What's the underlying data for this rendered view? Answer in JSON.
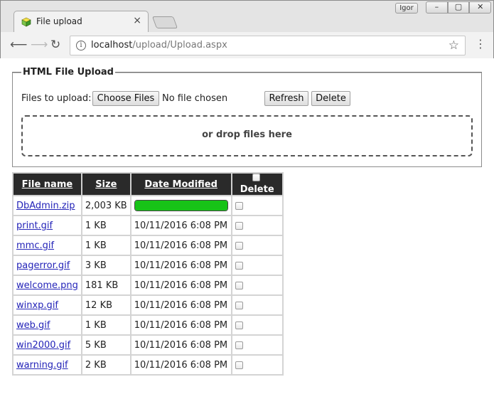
{
  "browser": {
    "tab_title": "File upload",
    "tab_close": "×",
    "user_name": "Igor",
    "url_host": "localhost",
    "url_path": "/upload/Upload.aspx"
  },
  "upload": {
    "legend": "HTML File Upload",
    "files_label": "Files to upload:",
    "choose_button": "Choose Files",
    "no_file_text": "No file chosen",
    "refresh_button": "Refresh",
    "delete_button": "Delete",
    "drop_text": "or drop files here"
  },
  "table": {
    "headers": {
      "name": "File name",
      "size": "Size",
      "date": "Date Modified",
      "delete": "Delete"
    },
    "rows": [
      {
        "name": "DbAdmin.zip",
        "size": "2,003 KB",
        "date": "",
        "progress": 1.0
      },
      {
        "name": "print.gif",
        "size": "1 KB",
        "date": "10/11/2016 6:08 PM"
      },
      {
        "name": "mmc.gif",
        "size": "1 KB",
        "date": "10/11/2016 6:08 PM"
      },
      {
        "name": "pagerror.gif",
        "size": "3 KB",
        "date": "10/11/2016 6:08 PM"
      },
      {
        "name": "welcome.png",
        "size": "181 KB",
        "date": "10/11/2016 6:08 PM"
      },
      {
        "name": "winxp.gif",
        "size": "12 KB",
        "date": "10/11/2016 6:08 PM"
      },
      {
        "name": "web.gif",
        "size": "1 KB",
        "date": "10/11/2016 6:08 PM"
      },
      {
        "name": "win2000.gif",
        "size": "5 KB",
        "date": "10/11/2016 6:08 PM"
      },
      {
        "name": "warning.gif",
        "size": "2 KB",
        "date": "10/11/2016 6:08 PM"
      }
    ]
  },
  "colors": {
    "progress_fill": "#17c317",
    "header_bg": "#2a2a2a",
    "link": "#2323b8"
  }
}
